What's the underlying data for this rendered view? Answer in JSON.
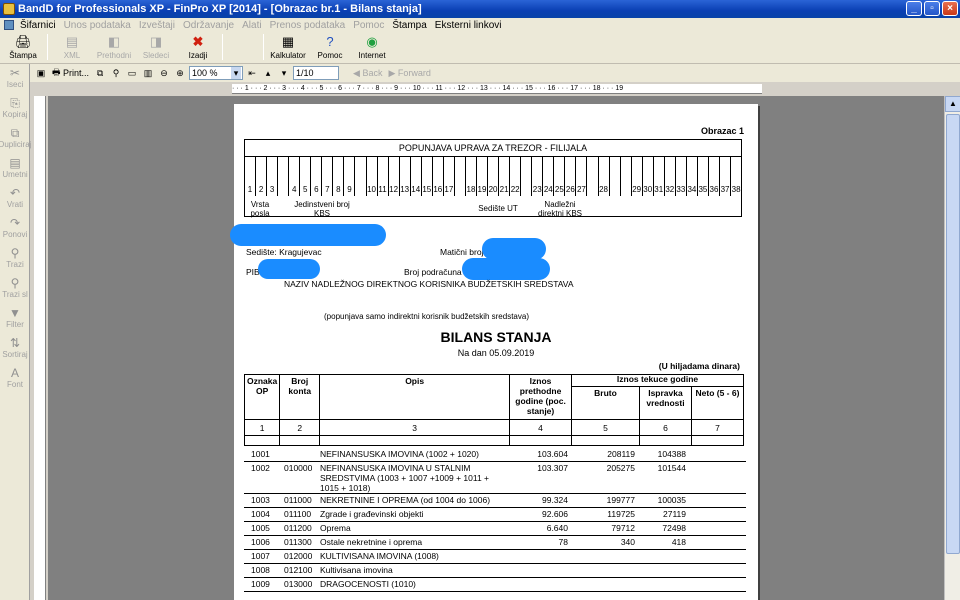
{
  "window": {
    "title": "BandD for Professionals XP - FinPro XP [2014] - [Obrazac br.1 - Bilans stanja]"
  },
  "menu": [
    {
      "label": "Šifarnici",
      "dis": false
    },
    {
      "label": "Unos podataka",
      "dis": true
    },
    {
      "label": "Izveštaji",
      "dis": true
    },
    {
      "label": "Održavanje",
      "dis": true
    },
    {
      "label": "Alati",
      "dis": true
    },
    {
      "label": "Prenos podataka",
      "dis": true
    },
    {
      "label": "Pomoc",
      "dis": true
    },
    {
      "label": "Štampa",
      "dis": false
    },
    {
      "label": "Eksterni linkovi",
      "dis": false
    }
  ],
  "toolbar": {
    "stampa": "Štampa",
    "xml": "XML",
    "prethodni": "Prethodni",
    "sledeci": "Sledeci",
    "izadji": "Izadji",
    "kalkulator": "Kalkulator",
    "pomoc": "Pomoc",
    "internet": "Internet"
  },
  "toolbar2": {
    "print": "Print...",
    "zoom": "100 %",
    "page": "1/10",
    "back": "Back",
    "forward": "Forward"
  },
  "leftbar": [
    "Iseci",
    "Kopiraj",
    "Dupliciraj",
    "Umetni",
    "Vrati",
    "Ponovi",
    "Trazi",
    "Trazi sl",
    "Filter",
    "Sortiraj",
    "Font"
  ],
  "ruler": "· · · 1 · · · 2 · · · 3 · · · 4 · · · 5 · · · 6 · · · 7 · · · 8 · · · 9 · · · 10 · · · 11 · · · 12 · · · 13 · · · 14 · · · 15 · · · 16 · · · 17 · · · 18 · · · 19",
  "doc": {
    "obrazac": "Obrazac 1",
    "trezor_header": "POPUNJAVA UPRAVA ZA TREZOR - FILIJALA",
    "trezor_numbers": [
      "1",
      "2",
      "3",
      "",
      "4",
      "5",
      "6",
      "7",
      "8",
      "9",
      "",
      "10",
      "11",
      "12",
      "13",
      "14",
      "15",
      "16",
      "17",
      "",
      "18",
      "19",
      "20",
      "21",
      "22",
      "",
      "23",
      "24",
      "25",
      "26",
      "27",
      "",
      "28",
      "",
      "",
      "29",
      "30",
      "31",
      "32",
      "33",
      "34",
      "35",
      "36",
      "37",
      "38"
    ],
    "vrsta": "Vrsta posla",
    "jedinstveni": "Jedinstveni broj KBS",
    "sediste_ut": "Sedište UT",
    "nadlezni": "Nadležni direktni KBS",
    "sediste": "Sedište: Kragujevac",
    "maticni": "Matični broj",
    "pib": "PIB",
    "podracun": "Broj podračuna",
    "naziv": "NAZIV NADLEŽNOG DIREKTNOG KORISNIKA BUDŽETSKIH SREDSTAVA",
    "popunjava": "(popunjava samo indirektni korisnik budžetskih sredstava)",
    "bilans": "BILANS STANJA",
    "na_dan": "Na dan 05.09.2019",
    "hiljade": "(U hiljadama dinara)",
    "headers": {
      "oznaka": "Oznaka OP",
      "konto": "Broj konta",
      "opis": "Opis",
      "prethodne": "Iznos prethodne godine (poc. stanje)",
      "tekuce": "Iznos tekuce godine",
      "bruto": "Bruto",
      "ispravka": "Ispravka vrednosti",
      "neto": "Neto (5 - 6)"
    },
    "colnums": [
      "1",
      "2",
      "3",
      "4",
      "5",
      "6",
      "7"
    ],
    "rows": [
      {
        "op": "1001",
        "konto": "",
        "opis": "NEFINANSUSKA IMOVINA (1002 + 1020)",
        "prev": "103.604",
        "bruto": "208119",
        "isp": "104388"
      },
      {
        "op": "1002",
        "konto": "010000",
        "opis": "NEFINANSUSKA IMOVINA U STALNIM SREDSTVIMA (1003 + 1007 +1009 + 1011 + 1015 + 1018)",
        "prev": "103.307",
        "bruto": "205275",
        "isp": "101544"
      },
      {
        "op": "1003",
        "konto": "011000",
        "opis": "NEKRETNINE I OPREMA (od 1004 do 1006)",
        "prev": "99.324",
        "bruto": "199777",
        "isp": "100035"
      },
      {
        "op": "1004",
        "konto": "011100",
        "opis": "Zgrade i građevinski objekti",
        "prev": "92.606",
        "bruto": "119725",
        "isp": "27119"
      },
      {
        "op": "1005",
        "konto": "011200",
        "opis": "Oprema",
        "prev": "6.640",
        "bruto": "79712",
        "isp": "72498"
      },
      {
        "op": "1006",
        "konto": "011300",
        "opis": "Ostale nekretnine i oprema",
        "prev": "78",
        "bruto": "340",
        "isp": "418"
      },
      {
        "op": "1007",
        "konto": "012000",
        "opis": "KULTIVISANA IMOVINA (1008)",
        "prev": "",
        "bruto": "",
        "isp": ""
      },
      {
        "op": "1008",
        "konto": "012100",
        "opis": "Kultivisana imovina",
        "prev": "",
        "bruto": "",
        "isp": ""
      },
      {
        "op": "1009",
        "konto": "013000",
        "opis": "DRAGOCENOSTI (1010)",
        "prev": "",
        "bruto": "",
        "isp": ""
      }
    ]
  }
}
